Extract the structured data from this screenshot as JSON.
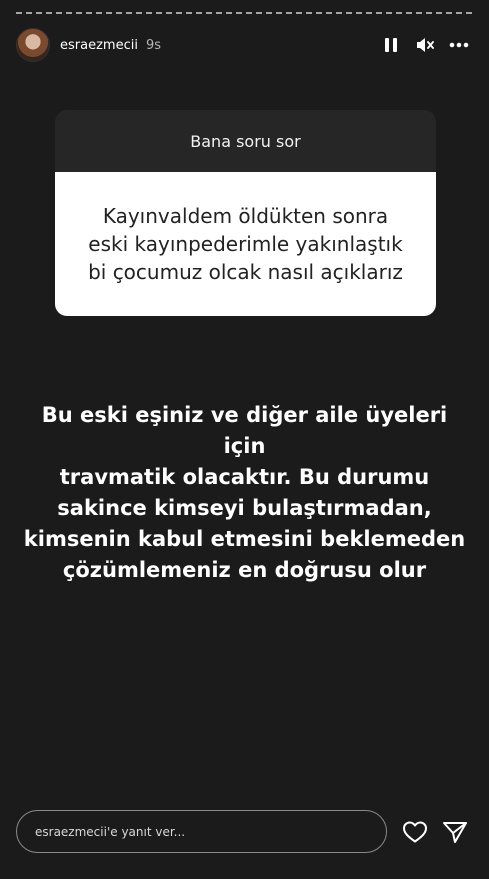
{
  "header": {
    "username": "esraezmecii",
    "time": "9s",
    "pause_icon": "pause-icon",
    "mute_icon": "muted-speaker-icon",
    "more_icon": "more-icon"
  },
  "question_card": {
    "title": "Bana soru sor",
    "lines": [
      "Kayınvaldem öldükten sonra",
      "eski kayınpederimle yakınlaştık",
      "bi çocumuz olcak nasıl açıklarız"
    ]
  },
  "answer": {
    "lines": [
      "Bu eski eşiniz ve diğer aile üyeleri için",
      "travmatik olacaktır. Bu durumu",
      "sakince kimseyi bulaştırmadan,",
      "kimsenin kabul etmesini beklemeden",
      "çözümlemeniz en doğrusu olur"
    ]
  },
  "footer": {
    "reply_placeholder": "esraezmecii'e yanıt ver...",
    "like_icon": "heart-icon",
    "send_icon": "send-icon"
  }
}
